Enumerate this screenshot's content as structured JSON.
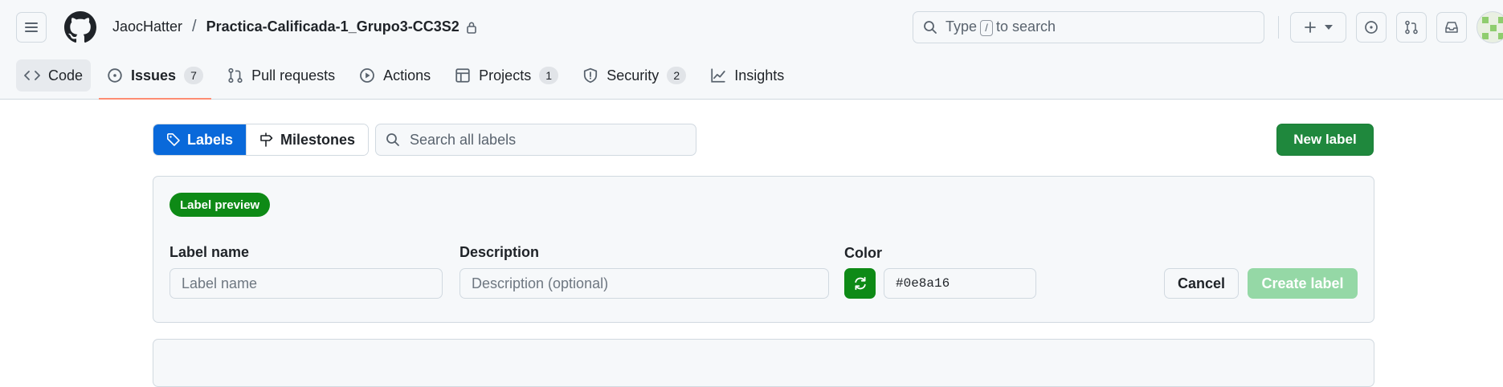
{
  "header": {
    "owner": "JaocHatter",
    "separator": "/",
    "repo": "Practica-Calificada-1_Grupo3-CC3S2",
    "search": {
      "prefix": "Type",
      "key": "/",
      "suffix": "to search"
    }
  },
  "tabs": [
    {
      "label": "Code",
      "icon": "code-icon"
    },
    {
      "label": "Issues",
      "icon": "issue-icon",
      "count": "7"
    },
    {
      "label": "Pull requests",
      "icon": "pull-request-icon"
    },
    {
      "label": "Actions",
      "icon": "play-icon"
    },
    {
      "label": "Projects",
      "icon": "table-icon",
      "count": "1"
    },
    {
      "label": "Security",
      "icon": "shield-icon",
      "count": "2"
    },
    {
      "label": "Insights",
      "icon": "graph-icon"
    }
  ],
  "toolbar": {
    "labels_tab": "Labels",
    "milestones_tab": "Milestones",
    "search_placeholder": "Search all labels",
    "new_label": "New label"
  },
  "form": {
    "preview": "Label preview",
    "name_label": "Label name",
    "name_placeholder": "Label name",
    "description_label": "Description",
    "description_placeholder": "Description (optional)",
    "color_label": "Color",
    "color_value": "#0e8a16",
    "cancel": "Cancel",
    "create": "Create label"
  },
  "colors": {
    "accent_blue": "#0969da",
    "primary_green": "#1f883d",
    "label_color": "#0e8a16",
    "active_tab_underline": "#fd8c73"
  }
}
